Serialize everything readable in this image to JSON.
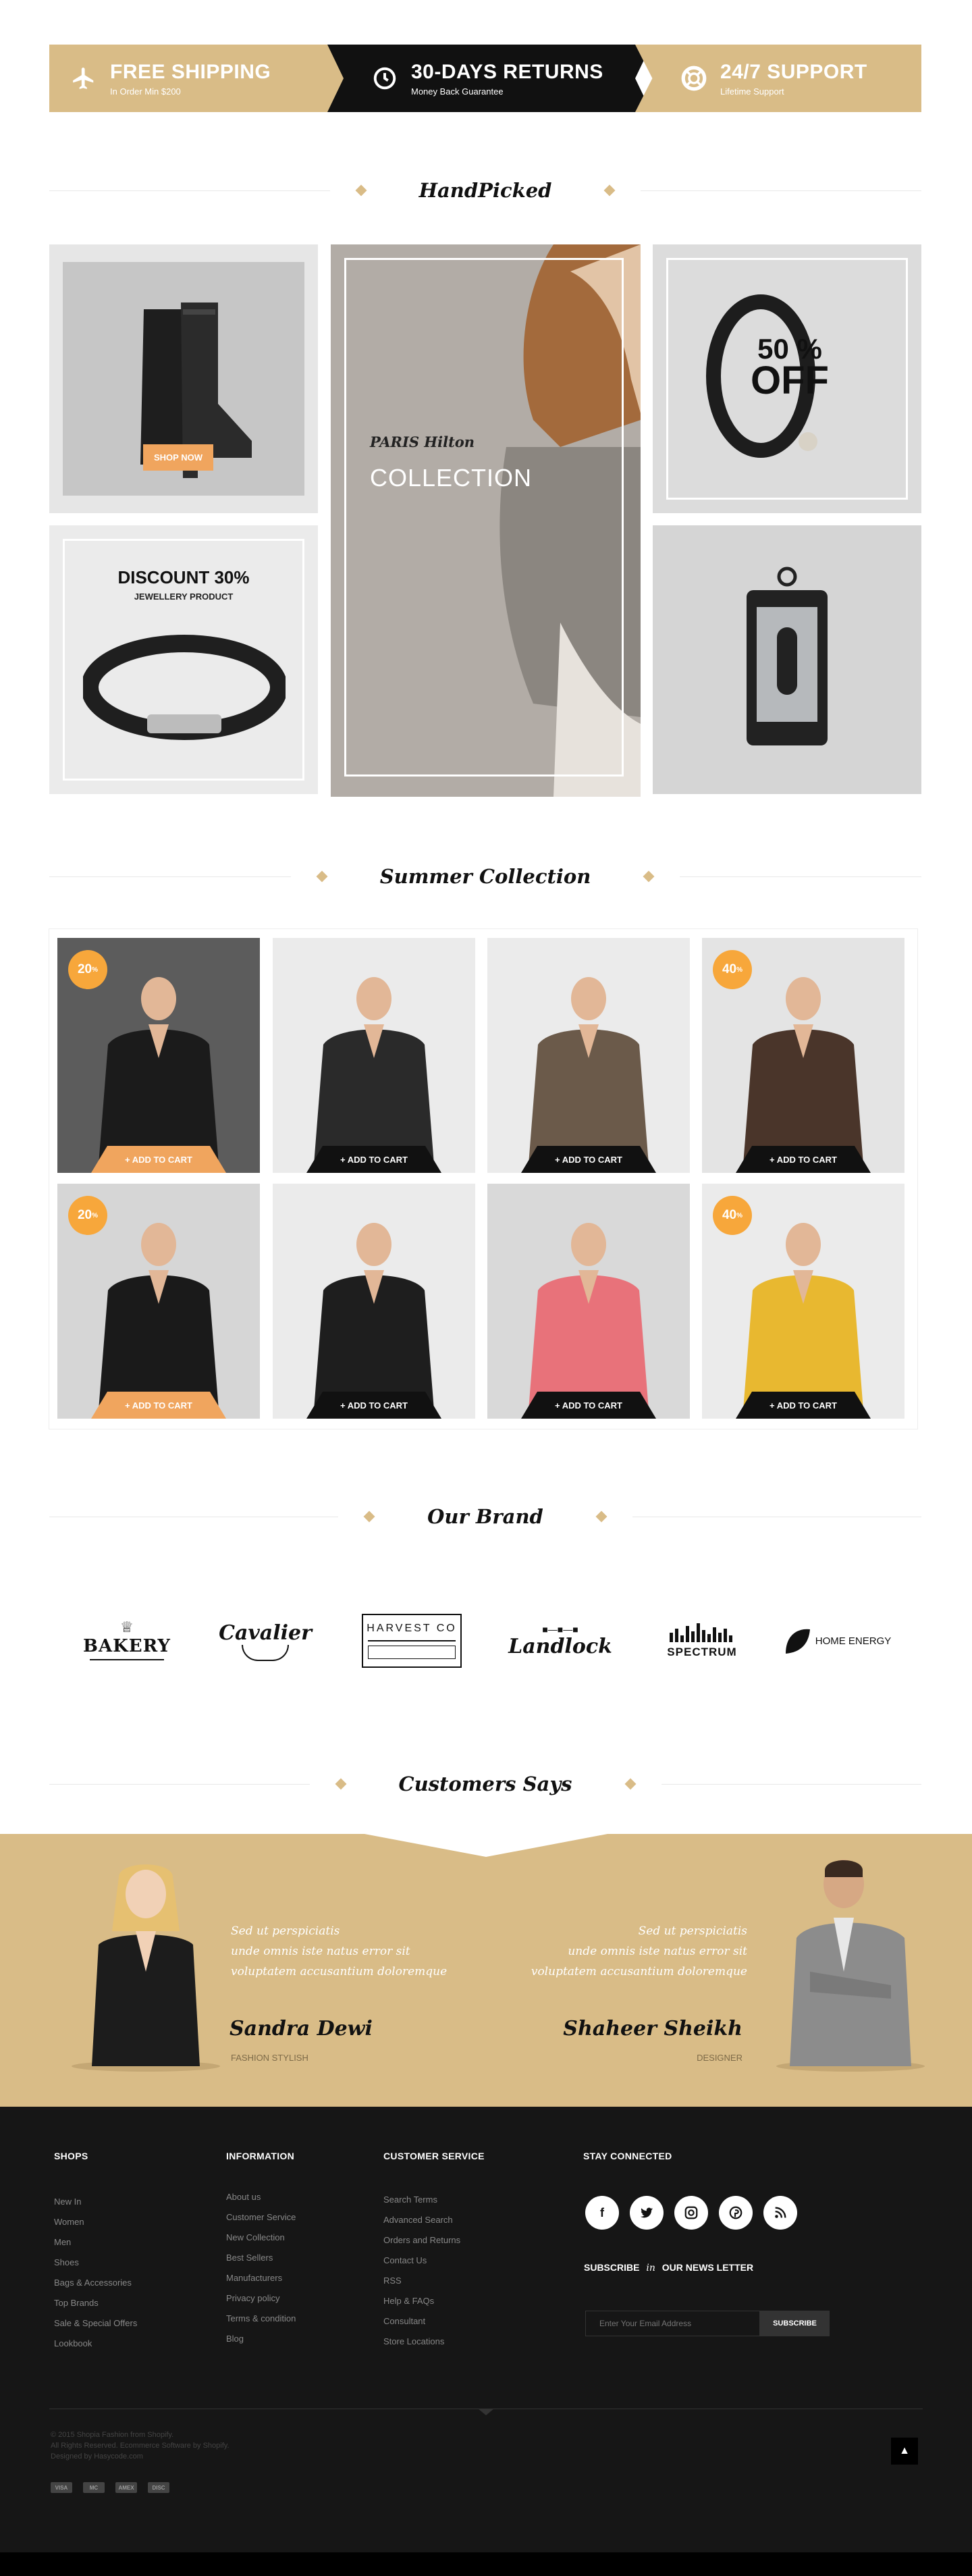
{
  "features": [
    {
      "title": "FREE SHIPPING",
      "sub": "In Order Min $200",
      "icon": "airplane-icon"
    },
    {
      "title": "30-DAYS RETURNS",
      "sub": "Money Back  Guarantee",
      "icon": "clock-icon"
    },
    {
      "title": "24/7 SUPPORT",
      "sub": "Lifetime Support",
      "icon": "lifebuoy-icon"
    }
  ],
  "handpicked": {
    "heading": "HandPicked",
    "shop_now": "SHOP NOW",
    "paris": "PARIS Hilton",
    "collection": "COLLECTION",
    "discount": "DISCOUNT 30%",
    "jewellery": "JEWELLERY PRODUCT",
    "off_pct": "50 %",
    "off_word": "OFF"
  },
  "summer": {
    "heading": "Summer Collection",
    "add_to_cart": "+ ADD TO CART",
    "products": [
      {
        "badge": "20",
        "tone": "#5c5c5c",
        "garment": "#1b1b1b",
        "cart": "orange"
      },
      {
        "badge": "",
        "tone": "#ebebeb",
        "garment": "#2a2a2a",
        "cart": "dark"
      },
      {
        "badge": "",
        "tone": "#ebebeb",
        "garment": "#6b5a4a",
        "cart": "dark"
      },
      {
        "badge": "40",
        "tone": "#e4e4e4",
        "garment": "#4a352a",
        "cart": "dark"
      },
      {
        "badge": "20",
        "tone": "#d6d6d6",
        "garment": "#1a1a1a",
        "cart": "orange"
      },
      {
        "badge": "",
        "tone": "#ebebeb",
        "garment": "#1e1e1e",
        "cart": "dark"
      },
      {
        "badge": "",
        "tone": "#d9d9d9",
        "garment": "#e8727a",
        "cart": "dark"
      },
      {
        "badge": "40",
        "tone": "#ebebeb",
        "garment": "#e8b830",
        "cart": "dark"
      }
    ]
  },
  "brand": {
    "heading": "Our Brand",
    "logos": [
      "BAKERY",
      "Cavalier",
      "HARVEST CO",
      "Landlock",
      "SPECTRUM",
      "HOME ENERGY"
    ]
  },
  "customers": {
    "heading": "Customers Says",
    "left": {
      "quote": [
        "Sed ut perspiciatis",
        "unde omnis iste natus error sit",
        "voluptatem accusantium doloremque"
      ],
      "name": "Sandra Dewi",
      "role": "FASHION STYLISH"
    },
    "right": {
      "quote": [
        "Sed ut perspiciatis",
        "unde omnis iste natus error sit",
        "voluptatem accusantium doloremque"
      ],
      "name": "Shaheer Sheikh",
      "role": "DESIGNER"
    }
  },
  "footer": {
    "shops_title": "SHOPS",
    "shops": [
      "New In",
      "Women",
      "Men",
      "Shoes",
      "Bags & Accessories",
      "Top Brands",
      "Sale & Special Offers",
      "Lookbook"
    ],
    "info_title": "INFORMATION",
    "info": [
      "About us",
      "Customer Service",
      "New Collection",
      "Best Sellers",
      "Manufacturers",
      "Privacy policy",
      "Terms & condition",
      "Blog"
    ],
    "cs_title": "CUSTOMER SERVICE",
    "cs": [
      "Search Terms",
      "Advanced Search",
      "Orders and Returns",
      "Contact Us",
      "RSS",
      "Help & FAQs",
      "Consultant",
      "Store Locations"
    ],
    "stay_title": "STAY CONNECTED",
    "subscribe": [
      "SUBSCRIBE",
      "in",
      "OUR NEWS LETTER"
    ],
    "email_placeholder": "Enter Your Email Address",
    "subscribe_btn": "SUBSCRIBE",
    "copyright": [
      "© 2015 Shopia Fashion from Shopify.",
      "All Rights Reserved. Ecommerce Software by Shopify.",
      "Designed by Hasycode.com"
    ],
    "payments": [
      "VISA",
      "MC",
      "AMEX",
      "DISC"
    ]
  }
}
